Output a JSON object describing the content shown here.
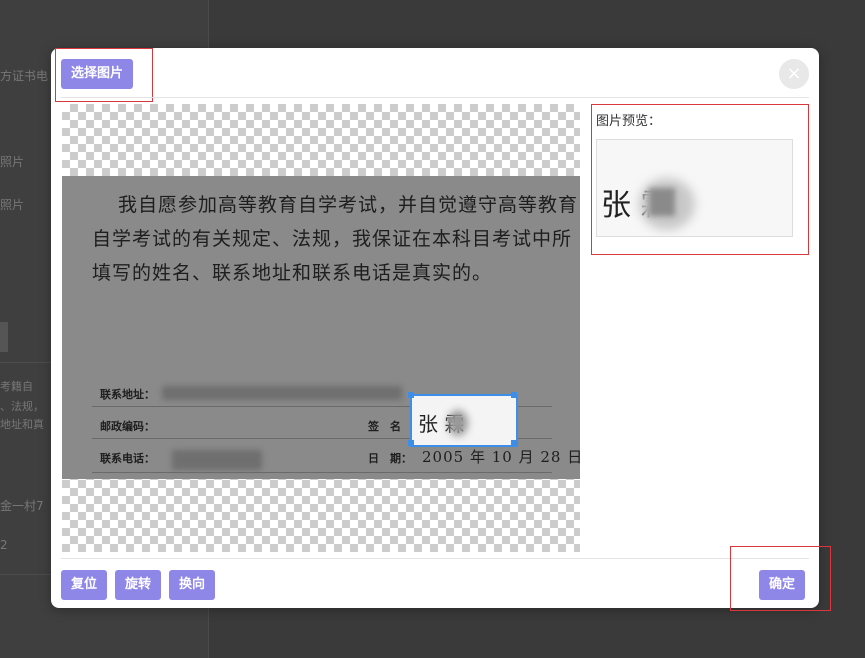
{
  "background": {
    "texts": [
      "方证书电",
      "照片",
      "照片",
      "考籍自",
      "、法规，",
      "地址和真",
      "金一村7",
      "2"
    ]
  },
  "dialog": {
    "select_image_label": "选择图片",
    "close_symbol": "×",
    "preview_label": "图片预览：",
    "reset_label": "复位",
    "rotate_label": "旋转",
    "flip_label": "换向",
    "confirm_label": "确定"
  },
  "document": {
    "line1": "我自愿参加高等教育自学考试，并自觉遵守高等教育",
    "line2": "自学考试的有关规定、法规，我保证在本科目考试中所",
    "line3": "填写的姓名、联系地址和联系电话是真实的。",
    "contact_address_label": "联系地址：",
    "postal_code_label": "邮政编码：",
    "contact_phone_label": "联系电话：",
    "signature_label": "签　名",
    "date_label": "日　期：",
    "date_value": "2005 年 10 月 28 日",
    "signature_visible_text": "张 霖"
  },
  "colors": {
    "button": "#8f87e8",
    "annotation_box": "#d9363e",
    "selection": "#3d8ee8"
  }
}
